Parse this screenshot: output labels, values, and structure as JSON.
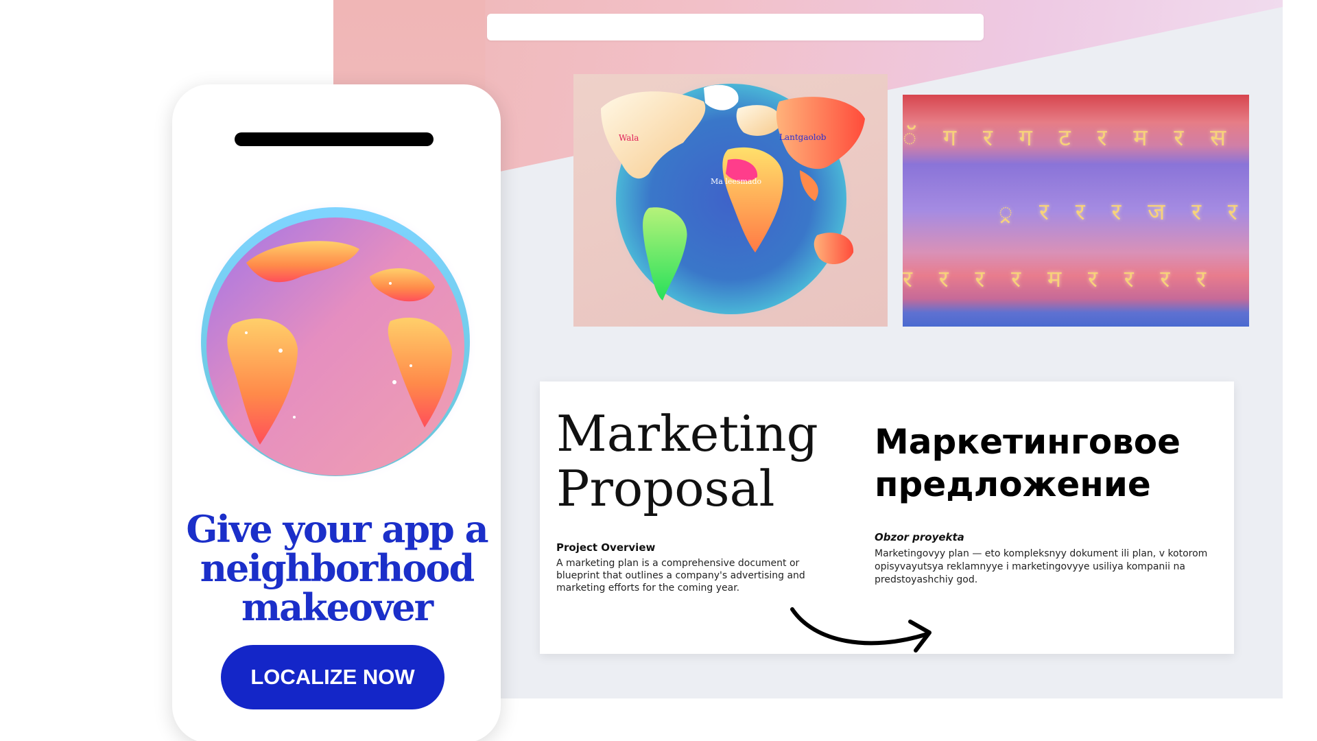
{
  "background": {
    "address_bar_value": ""
  },
  "map_card": {
    "labels": [
      "Wala",
      "Lantgaolob",
      "Ma leesmado"
    ]
  },
  "script_card": {
    "rows": [
      "ॅ ग र ग ट र म र स",
      "्र र र र ज र र",
      "र र र र म र र र र"
    ]
  },
  "doc": {
    "title_en": "Marketing\nProposal",
    "title_ru": "Маркетинговое\nпредложение",
    "heading_en": "Project Overview",
    "body_en": "A marketing plan is a comprehensive document or blueprint that outlines a company's advertising and marketing efforts for the coming year.",
    "heading_ru": "Obzor proyekta",
    "body_ru": "Marketingovyy plan — eto kompleksnyy dokument ili plan, v kotorom opisyvayutsya reklamnyye i marketingovyye usiliya kompanii na predstoyashchiy god."
  },
  "phone": {
    "headline": "Give your app a neighborhood makeover",
    "cta_label": "LOCALIZE NOW"
  },
  "colors": {
    "brand_blue": "#1426c8",
    "headline_blue": "#1b2fc9"
  },
  "icons": [
    "globe-illustration",
    "world-map-illustration",
    "curved-arrow-icon"
  ]
}
